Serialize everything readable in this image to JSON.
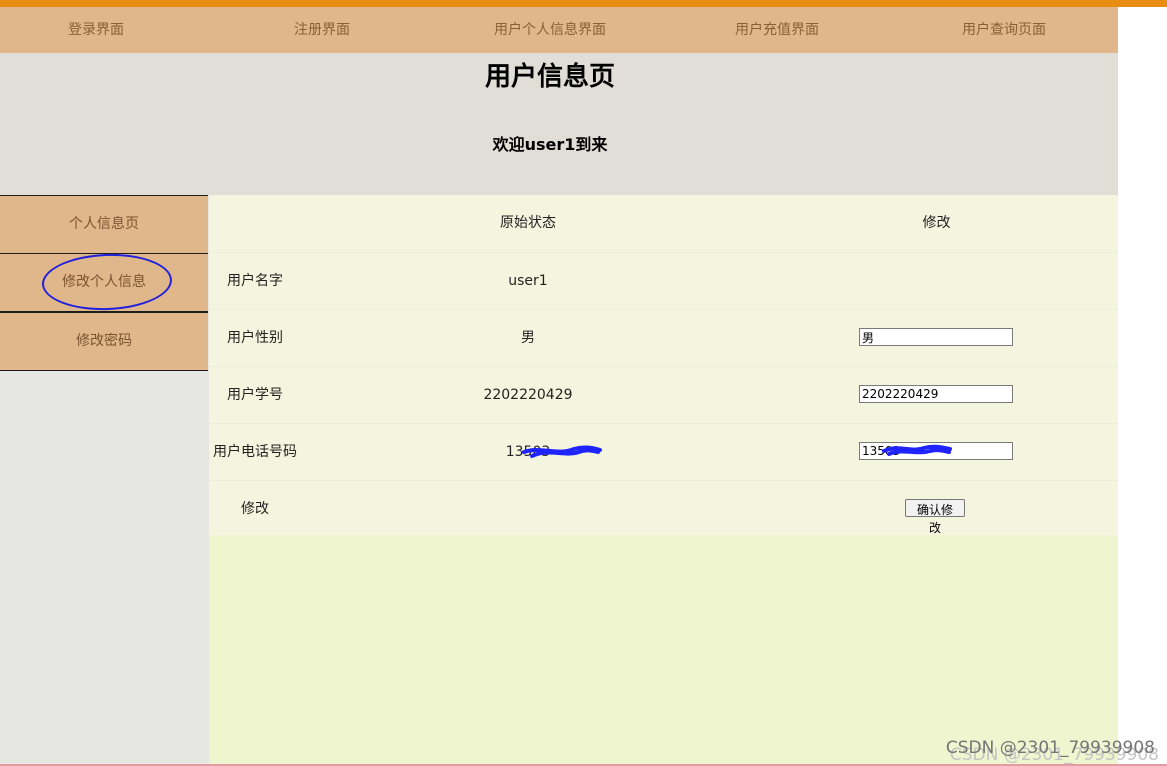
{
  "navigation": {
    "items": [
      "登录界面",
      "注册界面",
      "用户个人信息界面",
      "用户充值界面",
      "用户查询页面"
    ]
  },
  "header": {
    "title": "用户信息页",
    "welcome": "欢迎user1到来"
  },
  "sidebar": {
    "items": [
      "个人信息页",
      "修改个人信息",
      "修改密码"
    ]
  },
  "profile_table": {
    "headers": {
      "original": "原始状态",
      "edit": "修改"
    },
    "rows": [
      {
        "label": "用户名字",
        "value": "user1",
        "edit_value": ""
      },
      {
        "label": "用户性别",
        "value": "男",
        "edit_value": "男"
      },
      {
        "label": "用户学号",
        "value": "2202220429",
        "edit_value": "2202220429"
      },
      {
        "label": "用户电话号码",
        "value": "13503",
        "edit_value": "13503"
      }
    ],
    "action": {
      "label": "修改",
      "button_label": "确认修改"
    }
  },
  "watermark": "CSDN @2301_79939908"
}
